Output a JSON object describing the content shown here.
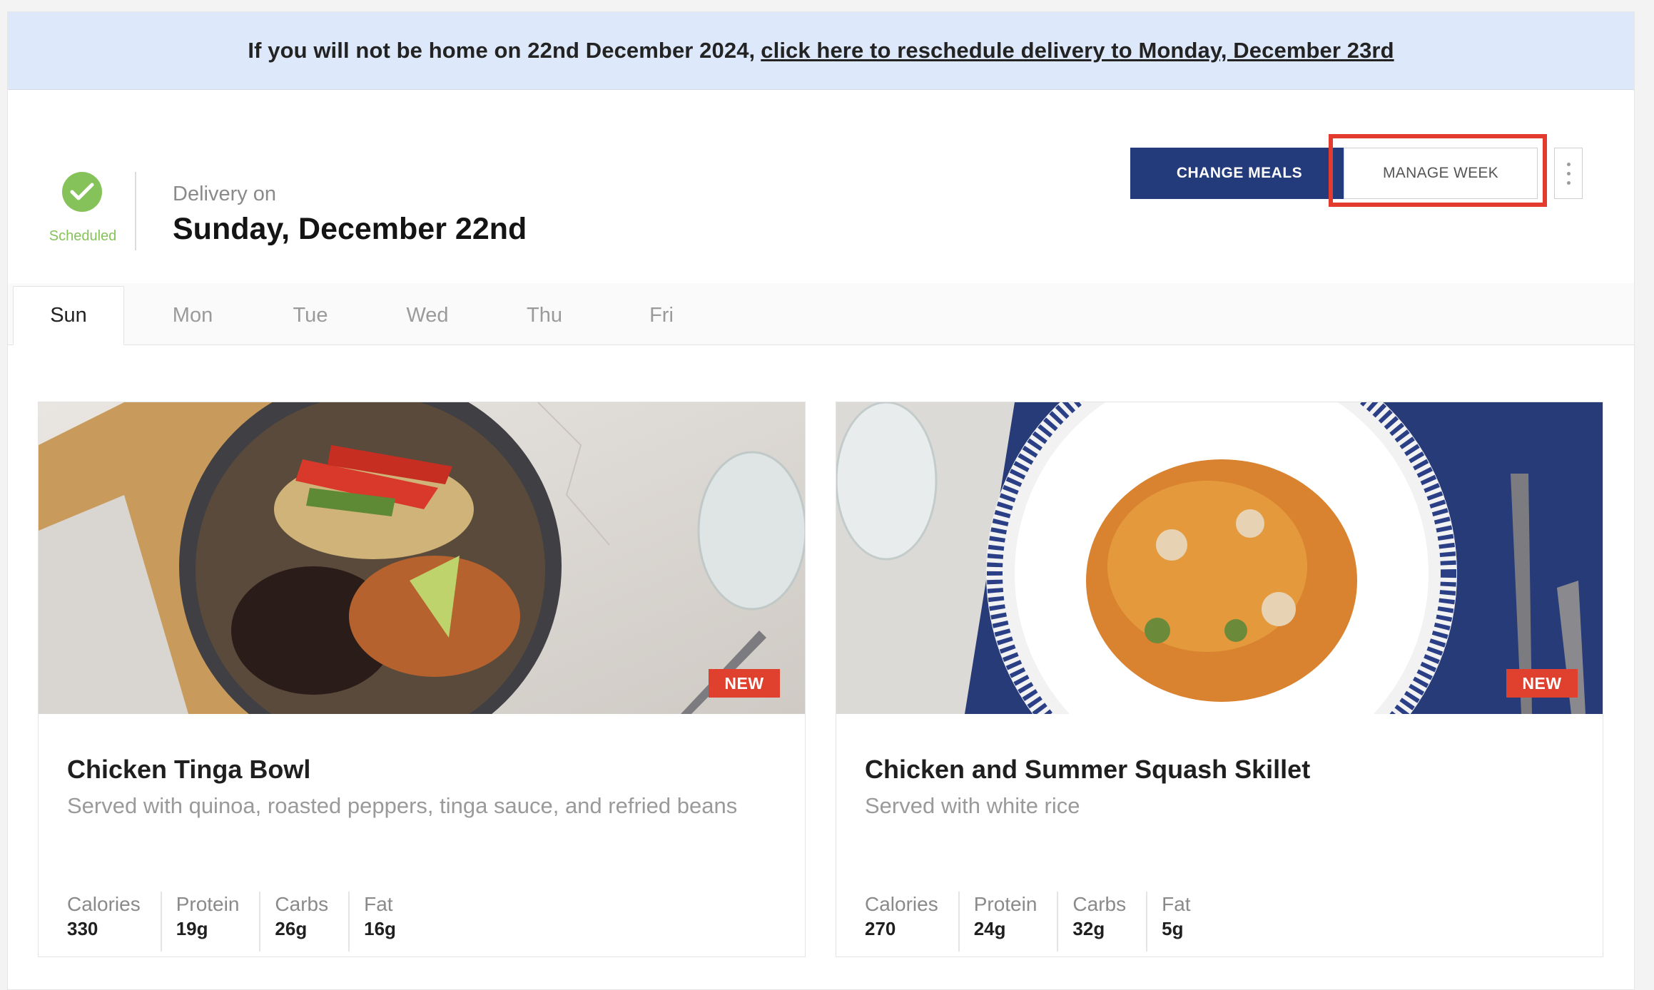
{
  "banner": {
    "text": "If you will not be home on 22nd December 2024,",
    "link": "click here to reschedule delivery to Monday, December 23rd"
  },
  "status": {
    "label": "Scheduled",
    "icon": "check-circle-icon",
    "color": "#86c25a"
  },
  "delivery": {
    "label": "Delivery on",
    "date": "Sunday, December 22nd"
  },
  "actions": {
    "change_meals": "CHANGE MEALS",
    "manage_week": "MANAGE WEEK",
    "more_icon": "more-vertical-icon"
  },
  "colors": {
    "primary": "#233a7b",
    "badge": "#e0412f",
    "highlight": "#e33b2e",
    "banner": "#dde9fa"
  },
  "tabs": [
    {
      "label": "Sun",
      "active": true
    },
    {
      "label": "Mon",
      "active": false
    },
    {
      "label": "Tue",
      "active": false
    },
    {
      "label": "Wed",
      "active": false
    },
    {
      "label": "Thu",
      "active": false
    },
    {
      "label": "Fri",
      "active": false
    }
  ],
  "meals": [
    {
      "badge": "NEW",
      "title": "Chicken Tinga Bowl",
      "description": "Served with quinoa, roasted peppers, tinga sauce, and refried beans",
      "nutrition": [
        {
          "label": "Calories",
          "value": "330"
        },
        {
          "label": "Protein",
          "value": "19g"
        },
        {
          "label": "Carbs",
          "value": "26g"
        },
        {
          "label": "Fat",
          "value": "16g"
        }
      ]
    },
    {
      "badge": "NEW",
      "title": "Chicken and Summer Squash Skillet",
      "description": "Served with white rice",
      "nutrition": [
        {
          "label": "Calories",
          "value": "270"
        },
        {
          "label": "Protein",
          "value": "24g"
        },
        {
          "label": "Carbs",
          "value": "32g"
        },
        {
          "label": "Fat",
          "value": "5g"
        }
      ]
    }
  ]
}
